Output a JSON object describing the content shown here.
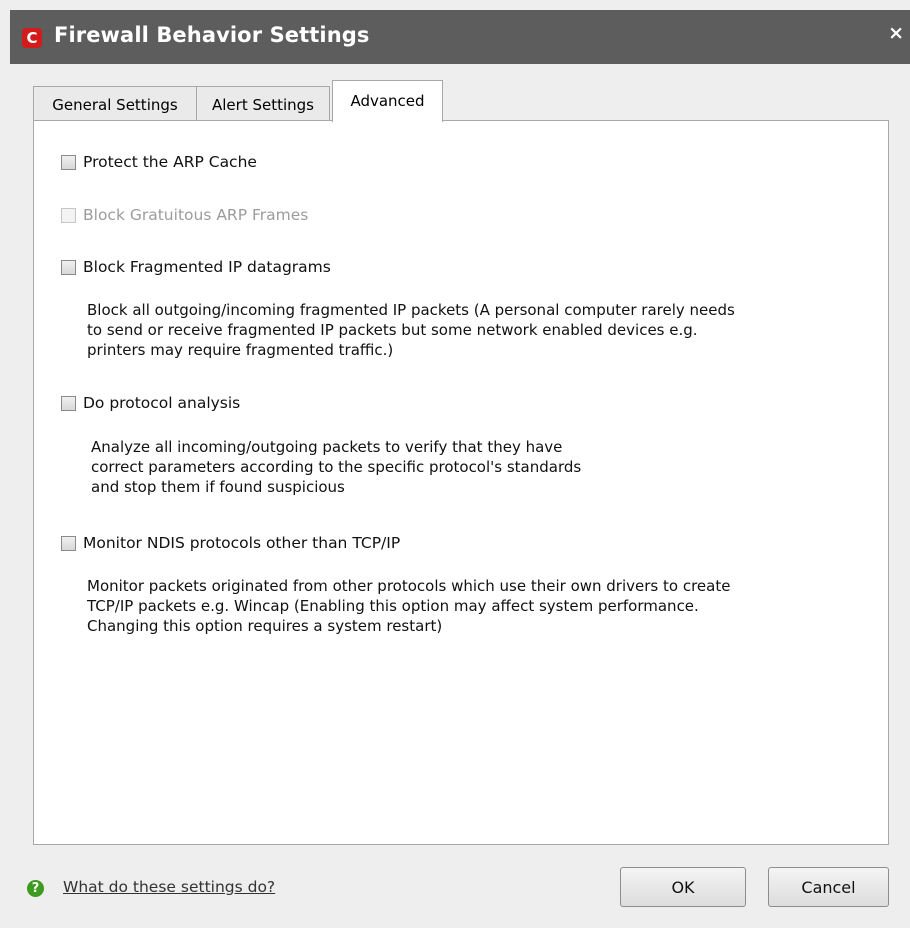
{
  "window": {
    "title": "Firewall Behavior Settings",
    "close_glyph": "×",
    "logo_glyph": "C"
  },
  "tabs": [
    {
      "label": "General Settings"
    },
    {
      "label": "Alert Settings"
    },
    {
      "label": "Advanced",
      "active": true
    }
  ],
  "options": [
    {
      "label": "Protect the ARP Cache",
      "checked": false,
      "disabled": false
    },
    {
      "label": "Block Gratuitous ARP Frames",
      "checked": false,
      "disabled": true
    },
    {
      "label": "Block Fragmented IP datagrams",
      "checked": false,
      "disabled": false,
      "description": [
        "Block all outgoing/incoming fragmented IP packets (A personal computer rarely needs",
        "to send or receive fragmented IP packets but some network enabled devices e.g.",
        "printers may require fragmented traffic.)"
      ]
    },
    {
      "label": "Do protocol analysis",
      "checked": false,
      "disabled": false,
      "description": [
        "Analyze all incoming/outgoing packets to verify that they have",
        "correct parameters according to the specific protocol's standards",
        "and stop them if found suspicious"
      ]
    },
    {
      "label": "Monitor NDIS protocols other than TCP/IP",
      "checked": false,
      "disabled": false,
      "description": [
        "Monitor packets originated from other protocols which use their own drivers to create",
        "TCP/IP packets e.g. Wincap (Enabling this option may affect system performance.",
        "Changing this option requires a system restart)"
      ]
    }
  ],
  "footer": {
    "help_glyph": "?",
    "help_link": "What do these settings do?",
    "ok": "OK",
    "cancel": "Cancel"
  },
  "colors": {
    "titlebar": "#5d5d5d",
    "logo_red": "#d41b1b",
    "help_green": "#3b9c1f"
  }
}
